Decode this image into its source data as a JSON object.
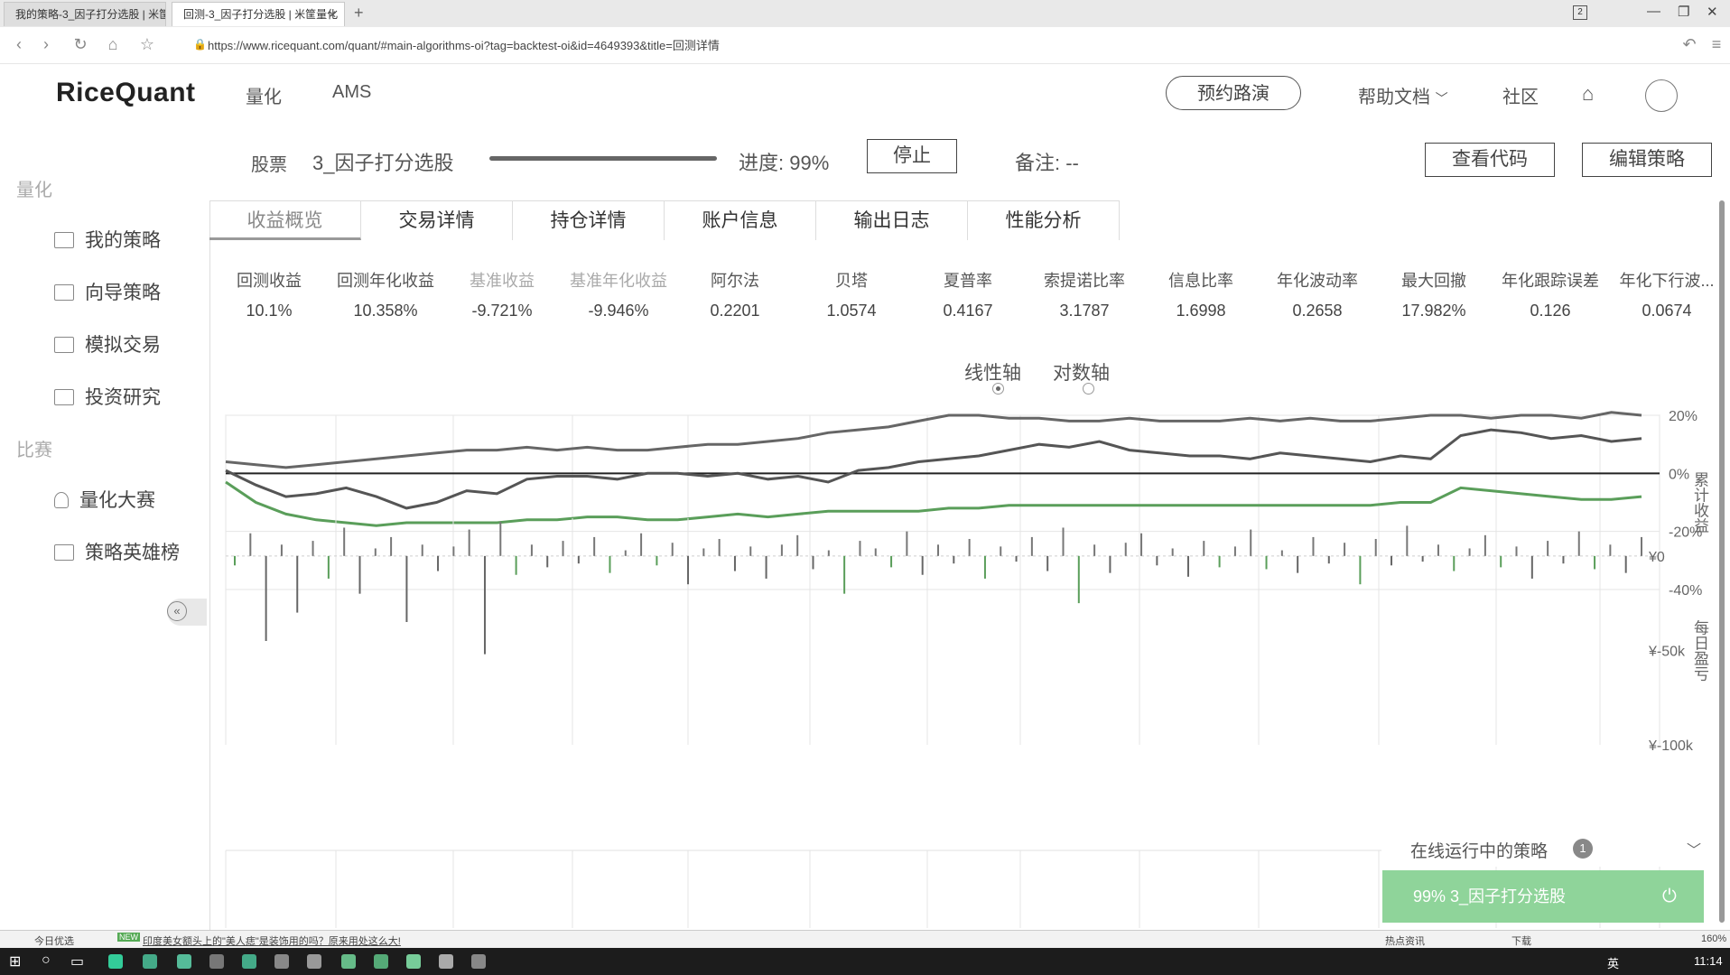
{
  "browser": {
    "tabs": [
      {
        "label": "我的策略-3_因子打分选股 | 米筐",
        "active": false
      },
      {
        "label": "回测-3_因子打分选股 | 米筐量化",
        "active": true
      }
    ],
    "new_tab": "+",
    "url": "https://www.ricequant.com/quant/#main-algorithms-oi?tag=backtest-oi&id=4649393&title=回测详情",
    "tab_count": "2"
  },
  "header": {
    "logo": "RiceQuant",
    "nav": [
      "量化",
      "AMS"
    ],
    "roadshow": "预约路演",
    "help": "帮助文档",
    "community": "社区"
  },
  "infobar": {
    "stock_label": "股票",
    "strategy_name": "3_因子打分选股",
    "progress_label": "进度: 99%",
    "progress": 0.99,
    "stop": "停止",
    "note": "备注: --",
    "view_code": "查看代码",
    "edit_strategy": "编辑策略"
  },
  "sidebar": {
    "group1": "量化",
    "items1": [
      "我的策略",
      "向导策略",
      "模拟交易",
      "投资研究"
    ],
    "group2": "比赛",
    "items2": [
      "量化大赛",
      "策略英雄榜"
    ]
  },
  "main_tabs": [
    "收益概览",
    "交易详情",
    "持仓详情",
    "账户信息",
    "输出日志",
    "性能分析"
  ],
  "metrics": [
    {
      "label": "回测收益",
      "value": "10.1%"
    },
    {
      "label": "回测年化收益",
      "value": "10.358%"
    },
    {
      "label": "基准收益",
      "value": "-9.721%"
    },
    {
      "label": "基准年化收益",
      "value": "-9.946%"
    },
    {
      "label": "阿尔法",
      "value": "0.2201"
    },
    {
      "label": "贝塔",
      "value": "1.0574"
    },
    {
      "label": "夏普率",
      "value": "0.4167"
    },
    {
      "label": "索提诺比率",
      "value": "3.1787"
    },
    {
      "label": "信息比率",
      "value": "1.6998"
    },
    {
      "label": "年化波动率",
      "value": "0.2658"
    },
    {
      "label": "最大回撤",
      "value": "17.982%"
    },
    {
      "label": "年化跟踪误差",
      "value": "0.126"
    },
    {
      "label": "年化下行波...",
      "value": "0.0674"
    }
  ],
  "axis_options": {
    "linear": "线性轴",
    "log": "对数轴",
    "selected": "linear"
  },
  "chart_data": [
    {
      "type": "line",
      "ylabel": "累计收益",
      "yticks": [
        "20%",
        "0%",
        "-20%",
        "-40%"
      ],
      "ylim": [
        -40,
        20
      ],
      "series": [
        {
          "values": [
            4,
            3,
            2,
            3,
            4,
            5,
            6,
            7,
            8,
            8,
            9,
            8,
            9,
            8,
            8,
            9,
            10,
            10,
            11,
            12,
            14,
            15,
            16,
            18,
            20,
            20,
            19,
            19,
            18,
            18,
            19,
            18,
            18,
            18,
            19,
            18,
            19,
            18,
            18,
            19,
            20,
            20,
            19,
            20,
            20,
            19,
            21,
            20
          ],
          "color": "#666666"
        },
        {
          "values": [
            1,
            -4,
            -8,
            -7,
            -5,
            -8,
            -12,
            -10,
            -6,
            -7,
            -2,
            -1,
            -1,
            -2,
            0,
            0,
            -1,
            0,
            -2,
            -1,
            -3,
            1,
            2,
            4,
            5,
            6,
            8,
            10,
            9,
            11,
            8,
            7,
            6,
            6,
            5,
            7,
            6,
            5,
            4,
            6,
            5,
            13,
            15,
            14,
            12,
            13,
            11,
            12
          ],
          "color": "#555555"
        },
        {
          "values": [
            -3,
            -10,
            -14,
            -16,
            -17,
            -18,
            -17,
            -17,
            -17,
            -17,
            -16,
            -16,
            -15,
            -15,
            -16,
            -16,
            -15,
            -14,
            -15,
            -14,
            -13,
            -13,
            -13,
            -13,
            -12,
            -12,
            -11,
            -11,
            -11,
            -11,
            -11,
            -11,
            -11,
            -11,
            -11,
            -11,
            -11,
            -11,
            -11,
            -10,
            -10,
            -5,
            -6,
            -7,
            -8,
            -9,
            -9,
            -8
          ],
          "color": "#5a9e5a"
        }
      ]
    },
    {
      "type": "bar",
      "ylabel": "每日盈亏",
      "yticks": [
        "¥0",
        "¥-50k",
        "¥-100k"
      ],
      "ylim": [
        -100000,
        20000
      ],
      "values": [
        -5000,
        12000,
        -45000,
        6000,
        -30000,
        8000,
        -12000,
        15000,
        -20000,
        4000,
        10000,
        -35000,
        6000,
        -8000,
        5000,
        14000,
        -52000,
        18000,
        -10000,
        6000,
        -6000,
        8000,
        -4000,
        10000,
        -9000,
        3000,
        12000,
        -5000,
        7000,
        -15000,
        4000,
        9000,
        -8000,
        5000,
        -12000,
        6000,
        11000,
        -7000,
        3000,
        -20000,
        8000,
        4000,
        -6000,
        13000,
        -10000,
        6000,
        -4000,
        9000,
        -12000,
        5000,
        -3000,
        10000,
        -8000,
        15000,
        -25000,
        6000,
        -9000,
        7000,
        12000,
        -5000,
        4000,
        -11000,
        8000,
        -6000,
        5000,
        14000,
        -7000,
        3000,
        -9000,
        10000,
        -4000,
        7000,
        -15000,
        9000,
        -5000,
        16000,
        -3000,
        6000,
        -8000,
        4000,
        11000,
        -6000,
        5000,
        -12000,
        8000,
        -4000,
        13000,
        -7000,
        6000,
        -9000,
        10000
      ]
    }
  ],
  "online": {
    "label": "在线运行中的策略",
    "count": "1"
  },
  "running": {
    "label": "99% 3_因子打分选股"
  },
  "statusbar": {
    "left": "今日优选",
    "news": "印度美女额头上的\"美人痣\"是装饰用的吗？原来用处这么大!",
    "hot": "热点资讯",
    "download": "下载",
    "zoom": "160%"
  },
  "taskbar": {
    "ime": "英",
    "time": "11:14"
  }
}
